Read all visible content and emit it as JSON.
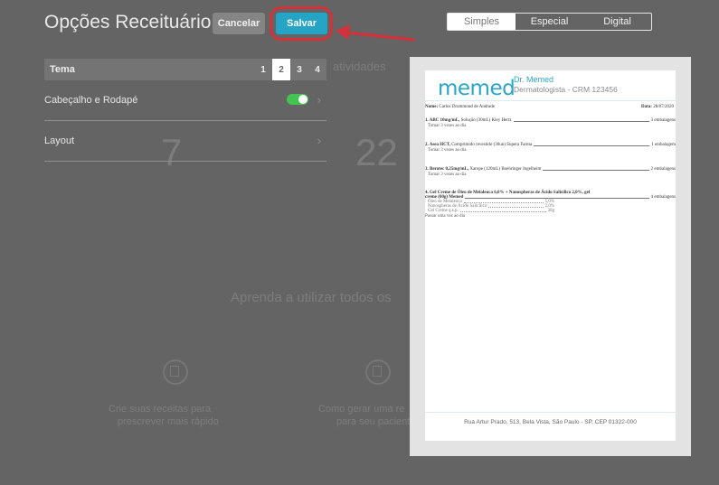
{
  "header": {
    "title": "Opções Receituário",
    "cancel_label": "Cancelar",
    "save_label": "Salvar"
  },
  "tabs": {
    "items": [
      {
        "label": "Simples"
      },
      {
        "label": "Especial"
      },
      {
        "label": "Digital"
      }
    ],
    "active": "Simples"
  },
  "menu": {
    "tema_label": "Tema",
    "tema_options": [
      "1",
      "2",
      "3",
      "4"
    ],
    "tema_selected": "2",
    "header_footer_label": "Cabeçalho e Rodapé",
    "header_footer_enabled": true,
    "layout_label": "Layout"
  },
  "background": {
    "big_left": "7",
    "big_right": "22",
    "mid_text": "Aprenda a utilizar todos os",
    "small_text_left_1": "Crie suas receitas para",
    "small_text_left_2": "prescrever mais rápido",
    "small_text_right_1": "Como gerar uma re",
    "small_text_right_2": "para seu paciente",
    "top_text": "atividades"
  },
  "prescription": {
    "logo": "memed",
    "doctor_name": "Dr. Memed",
    "doctor_specialty": "Dermatologista - CRM 123456",
    "patient_label": "Nome:",
    "patient_name": "Carlos Drummond de Andrade",
    "date_label": "Data:",
    "date_value": "28/07/2020",
    "items": [
      {
        "title": "1. ABC 10mg/mL,",
        "desc": "Solução (30mL) Kley Hertz",
        "qty": "3 embalagens",
        "instruction": "Tomar 3 vezes ao dia"
      },
      {
        "title": "2. Asea HCT,",
        "desc": "Comprimido revestido (30un) Supera Farma",
        "qty": "1 embalagem",
        "instruction": "Tomar 3 vezes ao dia"
      },
      {
        "title": "3. Berotec 0,25mg/mL,",
        "desc": "Xarope (120mL) Boehringer Ingelheim",
        "qty": "2 embalagens",
        "instruction": "Tomar 3 vezes ao dia"
      }
    ],
    "item4": {
      "title": "4. Gel Creme de Óleo de Melaleuca 6,0% + Nanospheras de Ácido Salicílico 2,0%, gel",
      "title2": "creme (60g) Memed",
      "qty": "4 embalagens",
      "components": [
        {
          "name": "Óleo de Melaleuca",
          "value": "5,0%"
        },
        {
          "name": "Nanospheras de Ácido Salicílico",
          "value": "2,0%"
        },
        {
          "name": "Gel Creme q.s.p.",
          "value": "30g"
        }
      ],
      "instruction": "Passar uma vez ao dia"
    },
    "footer": "Rua Artur Prado, 513, Bela Vista, São Paulo - SP, CEP 01322-000"
  }
}
